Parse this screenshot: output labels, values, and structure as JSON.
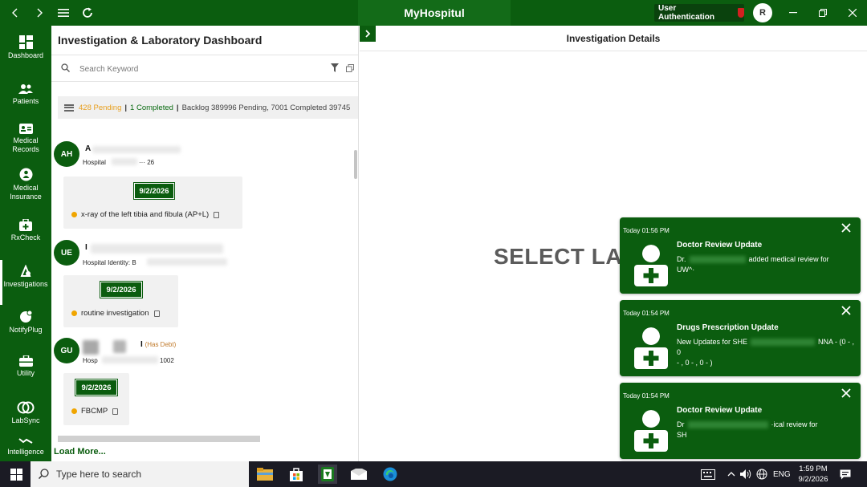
{
  "titlebar": {
    "app_title": "MyHospitul",
    "user_auth_label": "User Authentication",
    "avatar_initial": "R"
  },
  "sidebar": {
    "items": [
      {
        "label": "Dashboard",
        "icon": "dashboard-icon"
      },
      {
        "label": "Patients",
        "icon": "patients-icon"
      },
      {
        "label": "Medical Records",
        "icon": "medical-records-icon"
      },
      {
        "label": "Medical Insurance",
        "icon": "medical-insurance-icon"
      },
      {
        "label": "RxCheck",
        "icon": "rxcheck-icon"
      },
      {
        "label": "Investigations",
        "icon": "investigations-icon"
      },
      {
        "label": "NotifyPlug",
        "icon": "notifyplug-icon"
      },
      {
        "label": "Utility",
        "icon": "utility-icon"
      },
      {
        "label": "LabSync",
        "icon": "labsync-icon"
      },
      {
        "label": "Intelligence",
        "icon": "intelligence-icon"
      }
    ]
  },
  "left_pane": {
    "title": "Investigation & Laboratory Dashboard",
    "search_placeholder": "Search Keyword",
    "stats": {
      "pending": "428 Pending",
      "completed": "1 Completed",
      "backlog": "Backlog 389996 Pending,  7001 Completed  39745"
    },
    "patients": [
      {
        "initials": "AH",
        "name": "A",
        "identity": "Hospital",
        "identity_suffix": "··· 26",
        "date": "9/2/2026",
        "test": "x-ray of the left tibia and fibula (AP+L)"
      },
      {
        "initials": "UE",
        "name": "I",
        "identity": "Hospital Identity: B",
        "date": "9/2/2026",
        "test": "routine investigation"
      },
      {
        "initials": "GU",
        "name": "I",
        "debt": "(Has Debt)",
        "identity": "Hosp",
        "identity_suffix": "1002",
        "date": "9/2/2026",
        "test": "FBCMP"
      }
    ],
    "load_more": "Load More..."
  },
  "right_pane": {
    "title": "Investigation Details",
    "placeholder": "SELECT LAB"
  },
  "notifications": [
    {
      "time": "Today  01:56 PM",
      "title": "Doctor Review Update",
      "line1_a": "Dr.",
      "line1_b": "added medical review for",
      "line2": "UW^·"
    },
    {
      "time": "Today  01:54 PM",
      "title": "Drugs Prescription Update",
      "line1_a": "New Updates for SHE",
      "line1_b": "NNA - (0 - , 0",
      "line2": "- , 0 - , 0 - )"
    },
    {
      "time": "Today  01:54 PM",
      "title": "Doctor Review Update",
      "line1_a": "Dr",
      "line1_b": "·ical review for",
      "line2": "SH"
    }
  ],
  "taskbar": {
    "search_placeholder": "Type here to search",
    "language": "ENG",
    "time": "1:59 PM",
    "date": "9/2/2026"
  },
  "colors": {
    "brand_green": "#0b5d0f",
    "pending_orange": "#e8a020",
    "debt_orange": "#c0792a"
  }
}
